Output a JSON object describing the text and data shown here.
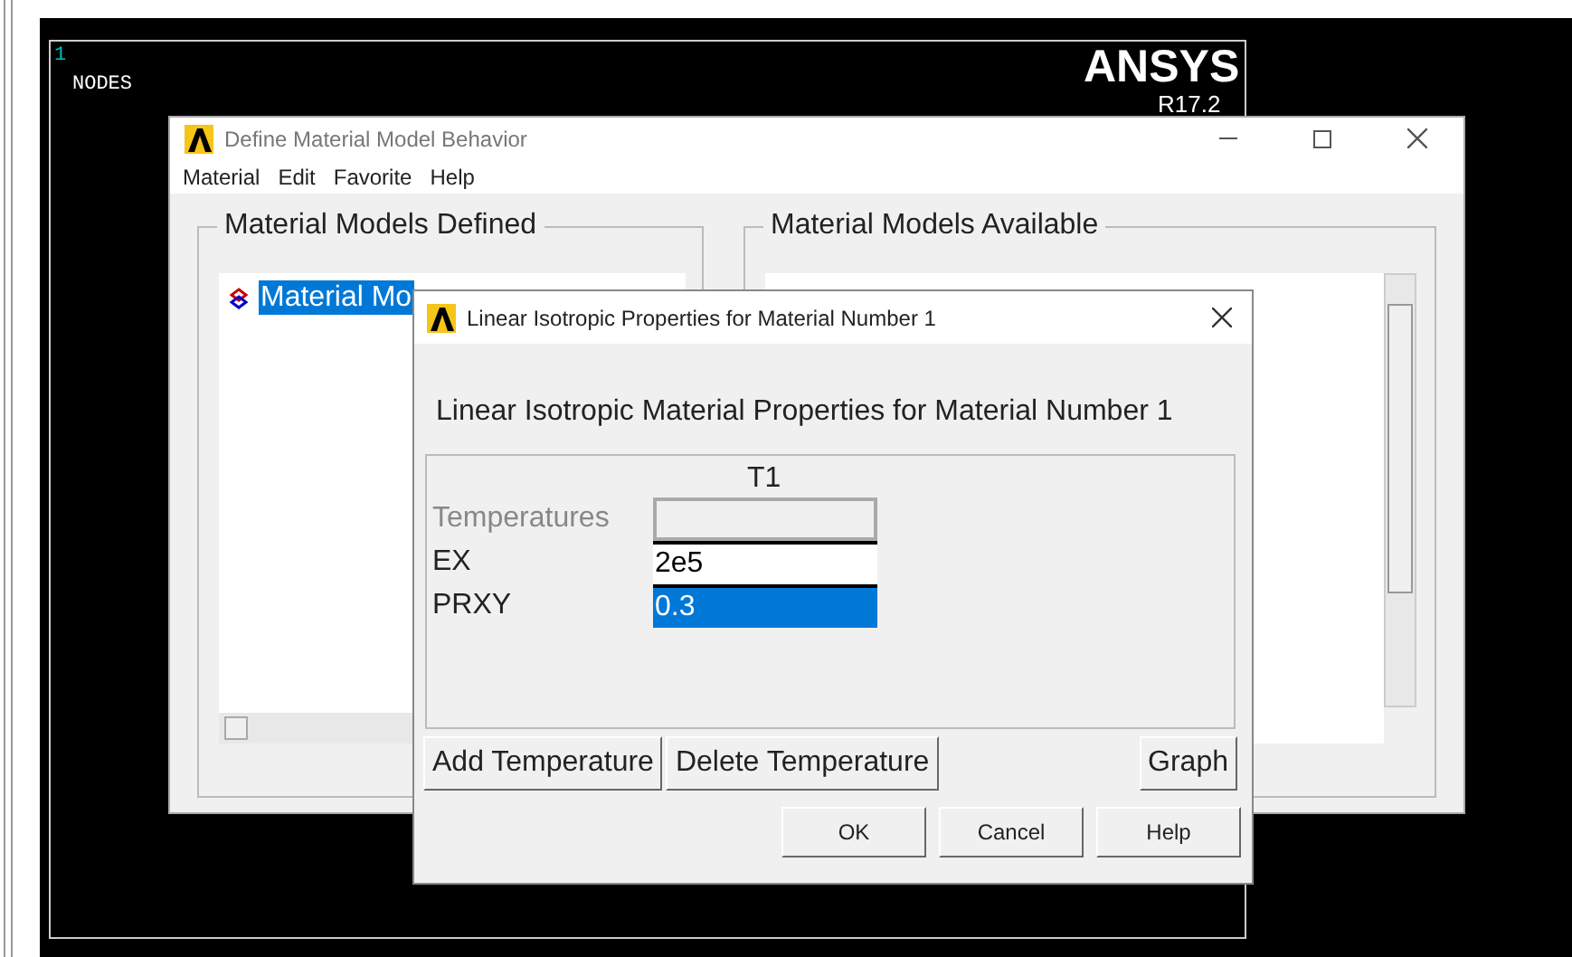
{
  "graphics": {
    "window_number": "1",
    "label": "NODES",
    "logo": "ANSYS",
    "version": "R17.2"
  },
  "material_window": {
    "title": "Define Material Model Behavior",
    "menu": [
      "Material",
      "Edit",
      "Favorite",
      "Help"
    ],
    "defined": {
      "title": "Material Models Defined",
      "items": [
        {
          "label": "Material Mo",
          "selected": true
        }
      ]
    },
    "available": {
      "title": "Material Models Available"
    }
  },
  "dialog": {
    "title": "Linear Isotropic Properties for Material Number 1",
    "heading": "Linear Isotropic Material Properties for Material Number 1",
    "column": "T1",
    "rows": [
      {
        "label": "Temperatures",
        "disabled": true,
        "selected": false
      },
      {
        "label": "EX",
        "value": "2e5",
        "disabled": false,
        "selected": false
      },
      {
        "label": "PRXY",
        "value": "0.3",
        "disabled": false,
        "selected": true
      }
    ],
    "table_buttons": [
      "Add Temperature",
      "Delete Temperature",
      "Graph"
    ],
    "buttons": [
      "OK",
      "Cancel",
      "Help"
    ]
  }
}
